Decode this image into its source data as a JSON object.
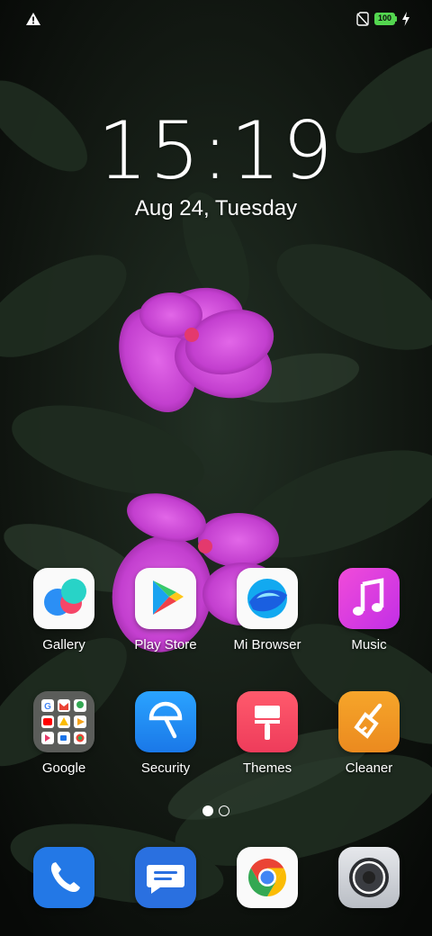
{
  "status_bar": {
    "battery_level": "100",
    "icons": [
      "warning-icon",
      "no-sim-icon",
      "battery-icon",
      "charging-bolt-icon"
    ]
  },
  "lock": {
    "time": "15:19",
    "date": "Aug 24, Tuesday"
  },
  "apps": [
    {
      "label": "Gallery",
      "icon": "gallery-icon"
    },
    {
      "label": "Play Store",
      "icon": "play-store-icon"
    },
    {
      "label": "Mi Browser",
      "icon": "mi-browser-icon"
    },
    {
      "label": "Music",
      "icon": "music-icon"
    },
    {
      "label": "Google",
      "icon": "google-folder-icon"
    },
    {
      "label": "Security",
      "icon": "security-icon"
    },
    {
      "label": "Themes",
      "icon": "themes-icon"
    },
    {
      "label": "Cleaner",
      "icon": "cleaner-icon"
    }
  ],
  "dock": [
    {
      "icon": "phone-icon"
    },
    {
      "icon": "messages-icon"
    },
    {
      "icon": "chrome-icon"
    },
    {
      "icon": "camera-icon"
    }
  ],
  "pager": {
    "current_page": 1,
    "page_count": 2
  },
  "colors": {
    "battery": "#53d64f",
    "music": "#e040e6",
    "security": "#1f8ff0",
    "themes": "#f0445f",
    "cleaner": "#f09a25",
    "phone": "#2378e6",
    "messages": "#2a70e0"
  }
}
